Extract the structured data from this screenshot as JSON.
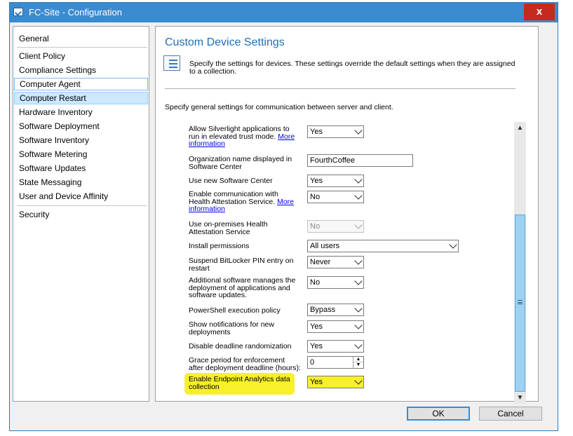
{
  "window": {
    "title": "FC-Site - Configuration",
    "close_label": "x"
  },
  "nav": {
    "items": [
      "General",
      "Client Policy",
      "Compliance Settings",
      "Computer Agent",
      "Computer Restart",
      "Hardware Inventory",
      "Software Deployment",
      "Software Inventory",
      "Software Metering",
      "Software Updates",
      "State Messaging",
      "User and Device Affinity",
      "Security"
    ]
  },
  "pane": {
    "heading": "Custom Device Settings",
    "intro": "Specify the settings for devices. These settings override the default settings when they are assigned to a collection.",
    "general_text": "Specify general settings for communication between server and client.",
    "more_link": "More information",
    "settings": {
      "silverlight": {
        "label": "Allow Silverlight applications to run in elevated trust mode.",
        "value": "Yes"
      },
      "org_name": {
        "label": "Organization name displayed in Software Center",
        "value": "FourthCoffee"
      },
      "new_sc": {
        "label": "Use new Software Center",
        "value": "Yes"
      },
      "health_attest": {
        "label": "Enable communication with Health Attestation Service.",
        "value": "No"
      },
      "onprem_health": {
        "label": "Use on-premises Health Attestation Service",
        "value": "No"
      },
      "install_perm": {
        "label": "Install permissions",
        "value": "All users"
      },
      "bitlocker": {
        "label": "Suspend BitLocker PIN entry on restart",
        "value": "Never"
      },
      "additional_sw": {
        "label": "Additional software manages the deployment of applications and software updates.",
        "value": "No"
      },
      "powershell": {
        "label": "PowerShell execution policy",
        "value": "Bypass"
      },
      "notifications": {
        "label": "Show notifications for new deployments",
        "value": "Yes"
      },
      "deadline_rand": {
        "label": "Disable deadline randomization",
        "value": "Yes"
      },
      "grace": {
        "label": "Grace period for enforcement after deployment deadline (hours):",
        "value": "0"
      },
      "endpoint_analytics": {
        "label": "Enable Endpoint Analytics data collection",
        "value": "Yes"
      }
    }
  },
  "buttons": {
    "ok": "OK",
    "cancel": "Cancel"
  },
  "colors": {
    "titlebar": "#3b8bd0",
    "close": "#c42b1c",
    "heading": "#1e6eb4",
    "highlight": "#f7f02a"
  }
}
